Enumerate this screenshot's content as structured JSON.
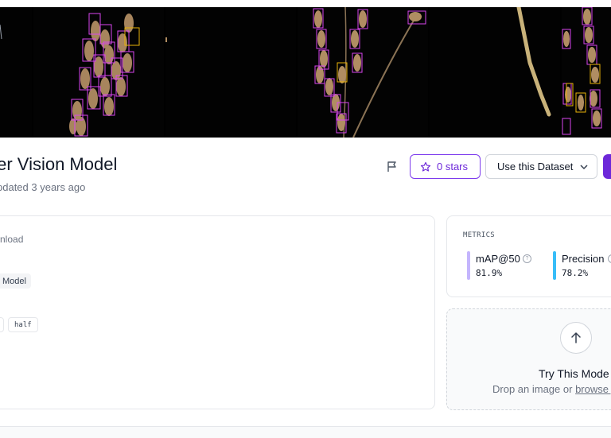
{
  "model": {
    "title": "ter Vision Model",
    "updated": "pdated 3 years ago"
  },
  "actions": {
    "stars_label": "0 stars",
    "use_dataset_label": "Use this Dataset"
  },
  "details": {
    "download_text": "nload",
    "model_tag": "Model",
    "chip_label": "half"
  },
  "metrics": {
    "section_label": "METRICS",
    "items": [
      {
        "name": "mAP@50",
        "value": "81.9%",
        "color": "#c4b5fd"
      },
      {
        "name": "Precision",
        "value": "78.2%",
        "color": "#38bdf8"
      }
    ]
  },
  "upload": {
    "title": "Try This Mode",
    "drop_text": "Drop an image or ",
    "browse_link": "browse y"
  },
  "colors": {
    "accent": "#6d28d9",
    "box_magenta": "#d946ef",
    "box_yellow": "#eab308"
  }
}
